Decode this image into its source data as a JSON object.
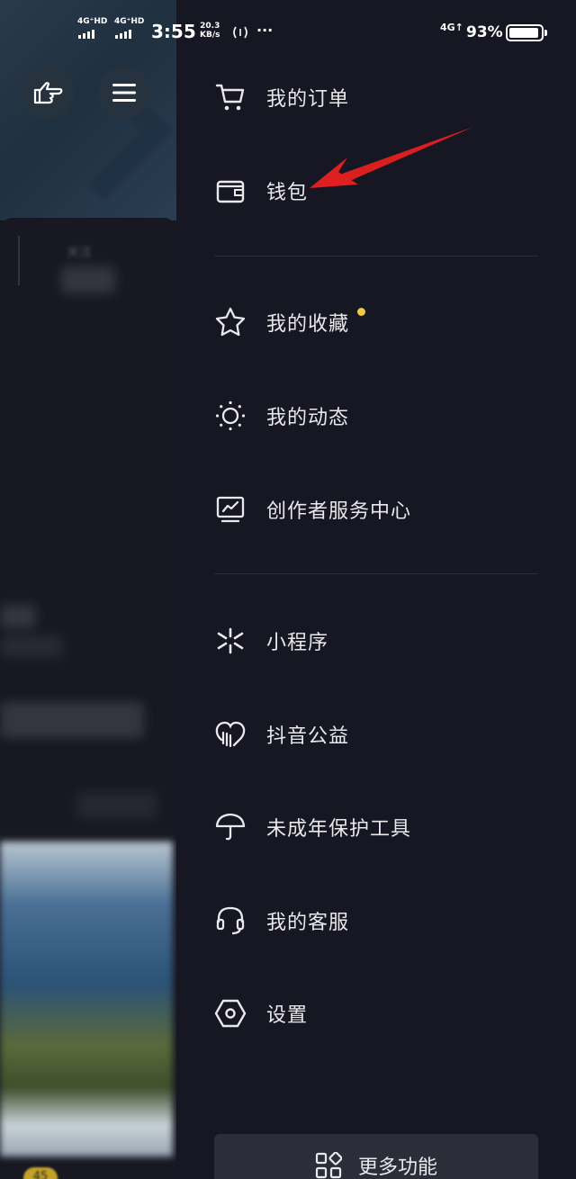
{
  "status_bar": {
    "network1": "4G⁺HD",
    "network2": "4G⁺HD",
    "time": "3:55",
    "speed_value": "20.3",
    "speed_unit": "KB/s",
    "more": "···",
    "net_right": "4G↑",
    "battery_pct": "93%",
    "battery_level": 0.93
  },
  "background": {
    "follow_label": "关注",
    "badge": "45"
  },
  "drawer": {
    "items": [
      {
        "label": "我的订单",
        "icon": "cart-icon"
      },
      {
        "label": "钱包",
        "icon": "wallet-icon"
      },
      {
        "label": "我的收藏",
        "icon": "star-icon",
        "has_dot": true
      },
      {
        "label": "我的动态",
        "icon": "sun-icon"
      },
      {
        "label": "创作者服务中心",
        "icon": "creator-chart-icon"
      },
      {
        "label": "小程序",
        "icon": "miniprogram-icon"
      },
      {
        "label": "抖音公益",
        "icon": "charity-heart-icon"
      },
      {
        "label": "未成年保护工具",
        "icon": "umbrella-icon"
      },
      {
        "label": "我的客服",
        "icon": "headset-icon"
      },
      {
        "label": "设置",
        "icon": "settings-hexagon-icon"
      }
    ],
    "more_button": {
      "label": "更多功能",
      "icon": "grid-apps-icon"
    }
  },
  "colors": {
    "drawer_bg": "#161722",
    "dot": "#f3c93f",
    "arrow": "#e02020"
  }
}
